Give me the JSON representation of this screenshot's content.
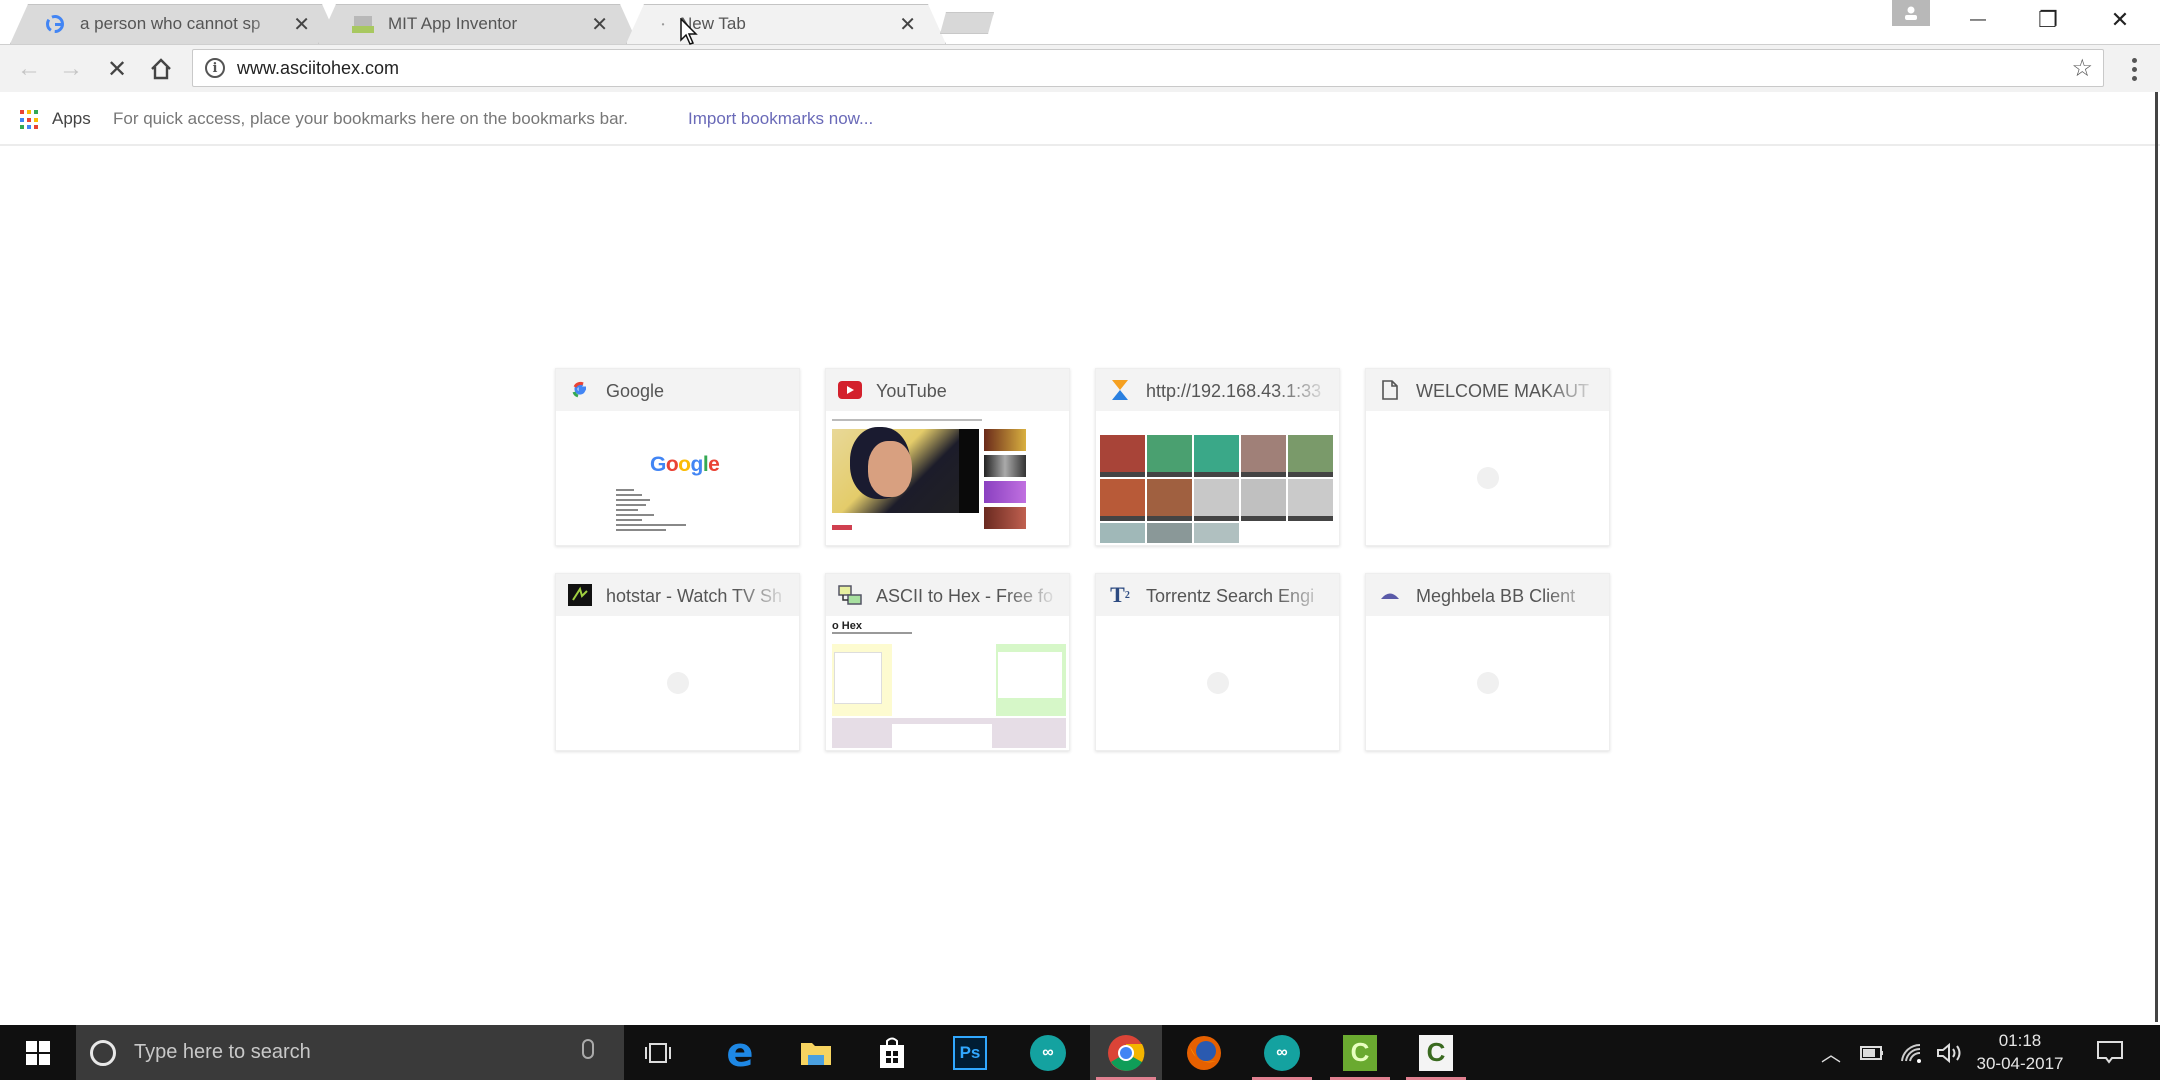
{
  "browser": {
    "tabs": [
      {
        "title": "a person who cannot sp",
        "favicon": "google-g-icon",
        "active": false
      },
      {
        "title": "MIT App Inventor",
        "favicon": "app-inventor-icon",
        "active": false
      },
      {
        "title": "New Tab",
        "favicon": "loading-icon",
        "active": true
      }
    ],
    "tab_close_glyph": "✕",
    "window_controls": {
      "minimize": "—",
      "restore": "❐",
      "close": "✕"
    },
    "omnibox": {
      "url": "www.asciitohex.com",
      "info_glyph": "i",
      "star_glyph": "☆"
    },
    "nav": {
      "back": "←",
      "forward": "→",
      "stop": "✕",
      "home": "⌂"
    },
    "bookmarks_bar": {
      "apps_label": "Apps",
      "hint": "For quick access, place your bookmarks here on the bookmarks bar.",
      "import_link": "Import bookmarks now..."
    }
  },
  "most_visited": [
    {
      "title": "Google",
      "icon": "google-g-icon",
      "thumb": "google"
    },
    {
      "title": "YouTube",
      "icon": "youtube-icon",
      "thumb": "youtube"
    },
    {
      "title": "http://192.168.43.1:33",
      "icon": "xender-icon",
      "thumb": "grid"
    },
    {
      "title": "WELCOME MAKAUT",
      "icon": "page-icon",
      "thumb": "loading"
    },
    {
      "title": "hotstar - Watch TV Sh",
      "icon": "hotstar-icon",
      "thumb": "loading"
    },
    {
      "title": "ASCII to Hex - Free fo",
      "icon": "asciitohex-icon",
      "thumb": "ascii"
    },
    {
      "title": "Torrentz Search Engi",
      "icon": "torrentz-icon",
      "thumb": "loading"
    },
    {
      "title": "Meghbela BB Client",
      "icon": "meghbela-icon",
      "thumb": "loading"
    }
  ],
  "thumb_text": {
    "google_logo": "Google",
    "ascii_heading": "o Hex"
  },
  "taskbar": {
    "search_placeholder": "Type here to search",
    "apps": [
      "Edge",
      "File Explorer",
      "Store",
      "Photoshop",
      "Arduino",
      "Chrome",
      "Firefox",
      "Arduino",
      "Camtasia",
      "Camtasia Recorder"
    ],
    "active_app": "Chrome",
    "clock": {
      "time": "01:18",
      "date": "30-04-2017"
    }
  }
}
